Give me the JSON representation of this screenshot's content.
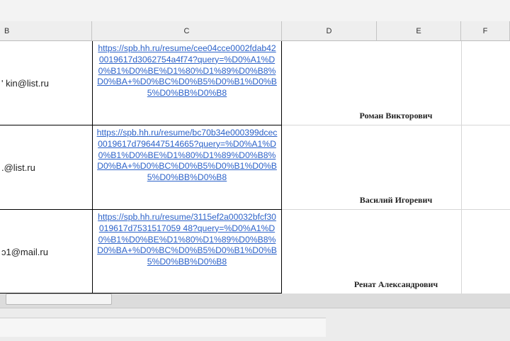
{
  "columns": [
    "B",
    "C",
    "D",
    "E",
    "F"
  ],
  "rows": [
    {
      "email": "' kin@list.ru",
      "link": "https://spb.hh.ru/resume/cee04cce0002fdab420019617d3062754a4f74?query=%D0%A1%D0%B1%D0%BE%D1%80%D1%89%D0%B8%D0%BA+%D0%BC%D0%B5%D0%B1%D0%B5%D0%BB%D0%B8",
      "name": "Роман Викторович"
    },
    {
      "email": ".@list.ru",
      "link": "https://spb.hh.ru/resume/bc70b34e000399dcec0019617d796447514665?query=%D0%A1%D0%B1%D0%BE%D1%80%D1%89%D0%B8%D0%BA+%D0%BC%D0%B5%D0%B1%D0%B5%D0%BB%D0%B8",
      "name": "Василий Игоревич"
    },
    {
      "email": "ɔ1@mail.ru",
      "link": "https://spb.hh.ru/resume/3115ef2a00032bfcf30019617d7531517059 48?query=%D0%A1%D0%B1%D0%BE%D1%80%D1%89%D0%B8%D0%BA+%D0%BC%D0%B5%D0%B1%D0%B5%D0%BB%D0%B8",
      "name": "Ренат Александрович"
    }
  ]
}
